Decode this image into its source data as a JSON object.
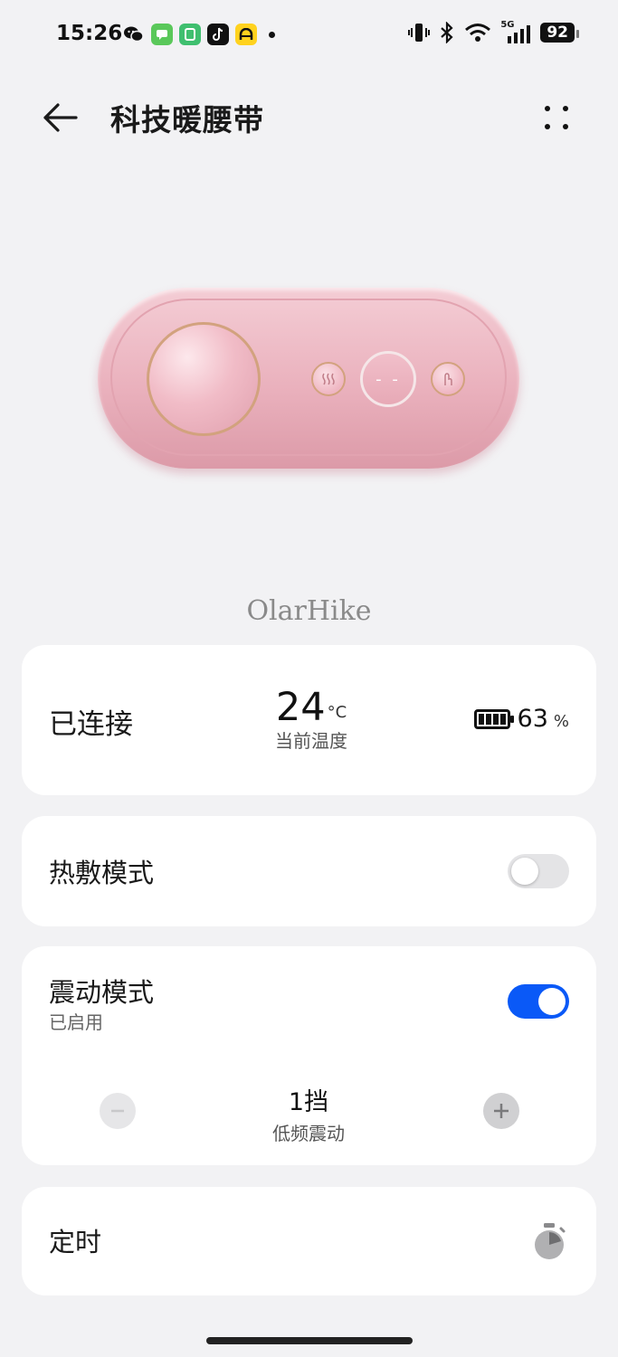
{
  "status_bar": {
    "time": "15:26",
    "notification_icons": [
      "wechat-icon",
      "messages-icon",
      "app-icon",
      "tiktok-icon",
      "app-yellow-icon"
    ],
    "signal_label": "5G",
    "battery": "92"
  },
  "header": {
    "title": "科技暖腰带"
  },
  "device": {
    "brand": "OlarHike",
    "mid_button_display": "- -"
  },
  "status_card": {
    "connection": "已连接",
    "temperature": "24",
    "temperature_unit": "°C",
    "temperature_caption": "当前温度",
    "battery_value": "63",
    "battery_unit": "%"
  },
  "heat_mode": {
    "title": "热敷模式",
    "enabled": false
  },
  "vibration_mode": {
    "title": "震动模式",
    "subtitle": "已启用",
    "enabled": true,
    "level": "1挡",
    "level_caption": "低频震动"
  },
  "timer": {
    "title": "定时"
  },
  "colors": {
    "accent": "#0a59f7",
    "background": "#f2f2f4",
    "device_pink": "#eab1bd"
  }
}
